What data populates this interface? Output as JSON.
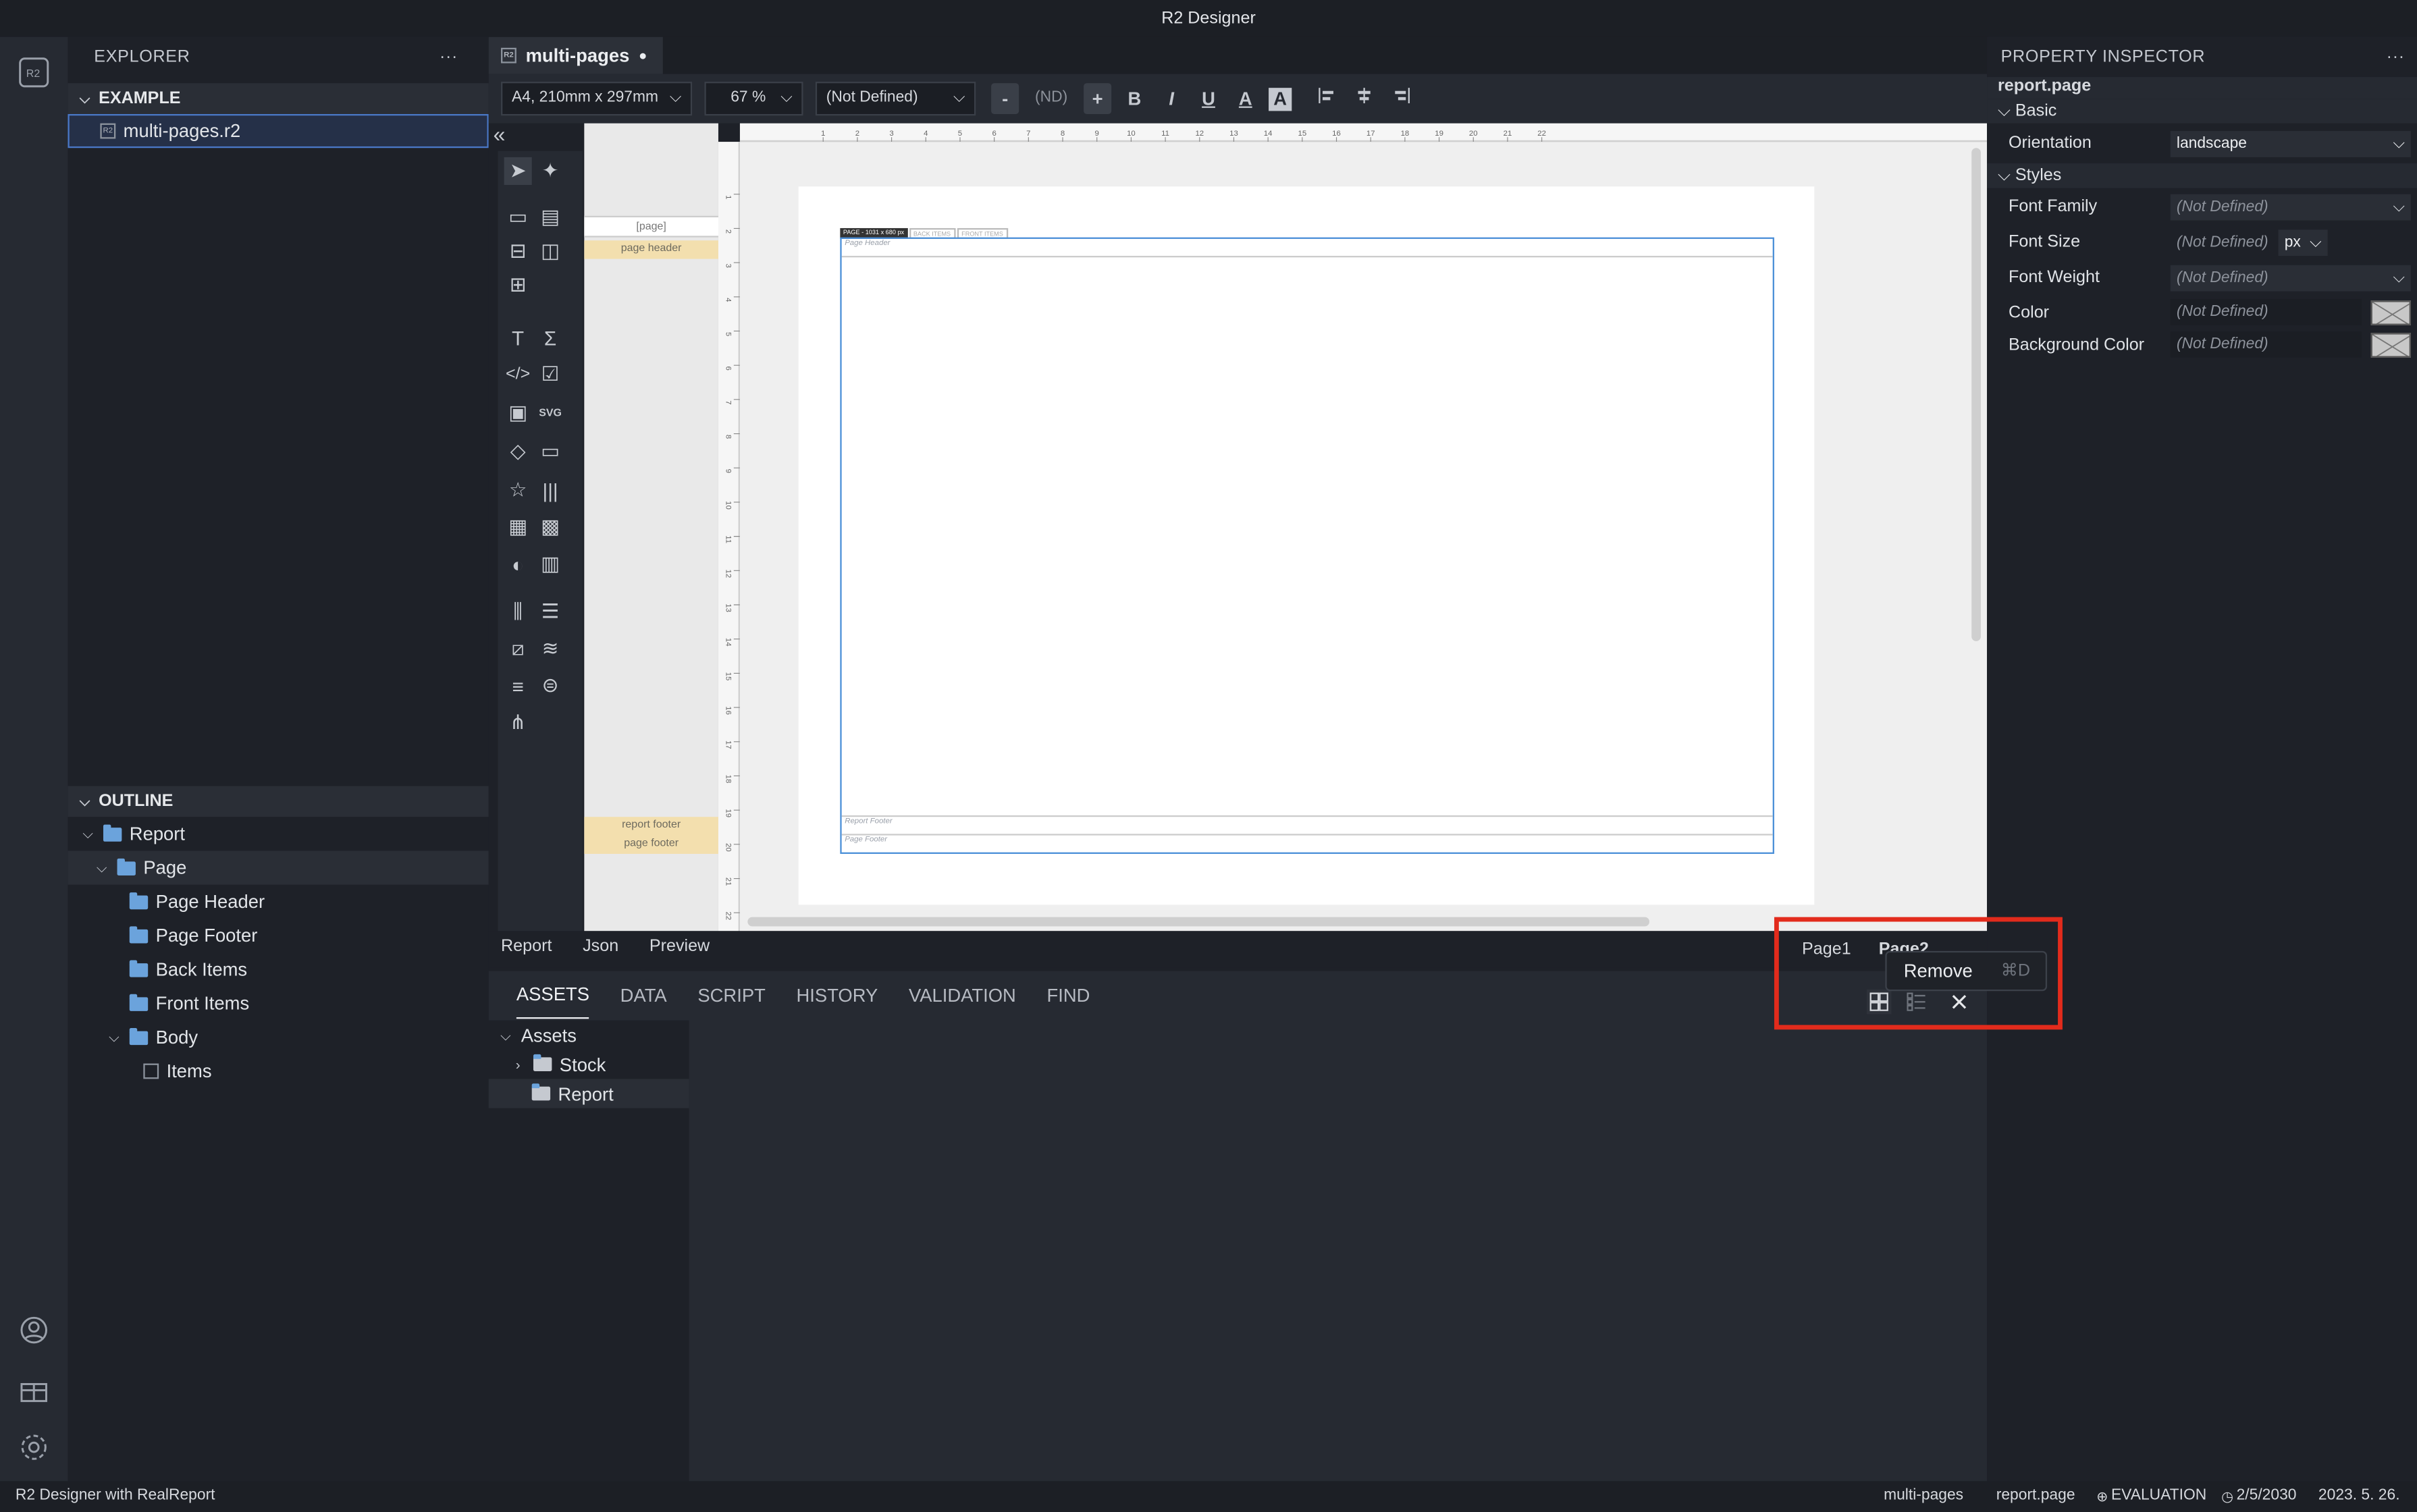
{
  "app": {
    "title": "R2 Designer"
  },
  "explorer": {
    "header": "EXPLORER",
    "more": "···",
    "section": "EXAMPLE",
    "file": "multi-pages.r2",
    "file_icon": "R2"
  },
  "outline": {
    "section": "OUTLINE",
    "items": [
      {
        "label": "Report"
      },
      {
        "label": "Page"
      },
      {
        "label": "Page Header"
      },
      {
        "label": "Page Footer"
      },
      {
        "label": "Back Items"
      },
      {
        "label": "Front Items"
      },
      {
        "label": "Body"
      },
      {
        "label": "Items"
      }
    ]
  },
  "editor": {
    "tab": "multi-pages",
    "tab_dirty": "●",
    "collapse_icon": "«",
    "toolbar": {
      "page_size": "A4, 210mm x 297mm",
      "zoom": "67 %",
      "font": "(Not Defined)",
      "minus": "-",
      "nd": "(ND)",
      "plus": "+",
      "bold": "B",
      "italic": "I",
      "underline": "U",
      "fontcolor": "A",
      "bgcolor": "A"
    },
    "bands": {
      "page": "[page]",
      "page_header": "page header",
      "report_footer": "report footer",
      "page_footer": "page footer"
    },
    "canvas": {
      "page_tag": "PAGE - 1031 x 680 px",
      "back_items": "BACK ITEMS",
      "front_items": "FRONT ITEMS",
      "page_header": "Page Header",
      "report_footer": "Report Footer",
      "page_footer": "Page Footer"
    },
    "ruler_h": [
      "1",
      "2",
      "3",
      "4",
      "5",
      "6",
      "7",
      "8",
      "9",
      "10",
      "11",
      "12",
      "13",
      "14",
      "15",
      "16",
      "17",
      "18",
      "19",
      "20",
      "21",
      "22"
    ],
    "ruler_v": [
      "1",
      "2",
      "3",
      "4",
      "5",
      "6",
      "7",
      "8",
      "9",
      "10",
      "11",
      "12",
      "13",
      "14",
      "15",
      "16",
      "17",
      "18",
      "19",
      "20",
      "21",
      "22"
    ],
    "view_tabs": [
      "Report",
      "Json",
      "Preview"
    ],
    "page_tabs": {
      "page1": "Page1",
      "page2": "Page2"
    },
    "context_menu": {
      "remove": "Remove",
      "shortcut": "⌘D"
    }
  },
  "bottom_panel": {
    "tabs": [
      "ASSETS",
      "DATA",
      "SCRIPT",
      "HISTORY",
      "VALIDATION",
      "FIND"
    ],
    "tree": [
      {
        "label": "Assets"
      },
      {
        "label": "Stock"
      },
      {
        "label": "Report"
      }
    ]
  },
  "inspector": {
    "header": "PROPERTY INSPECTOR",
    "more": "···",
    "target": "report.page",
    "basic": "Basic",
    "orientation_label": "Orientation",
    "orientation_value": "landscape",
    "styles": "Styles",
    "font_family_label": "Font Family",
    "font_family_value": "(Not Defined)",
    "font_size_label": "Font Size",
    "font_size_value": "(Not Defined)",
    "font_size_unit": "px",
    "font_weight_label": "Font Weight",
    "font_weight_value": "(Not Defined)",
    "color_label": "Color",
    "color_value": "(Not Defined)",
    "bgcolor_label": "Background Color",
    "bgcolor_value": "(Not Defined)"
  },
  "status": {
    "left": "R2 Designer with RealReport",
    "file": "multi-pages",
    "target": "report.page",
    "license": "EVALUATION",
    "expiry": "2/5/2030",
    "date": "2023. 5. 26."
  },
  "colors": {
    "accent": "#4a8fd8",
    "highlight": "#e22b1c",
    "band": "#f3dfae"
  }
}
